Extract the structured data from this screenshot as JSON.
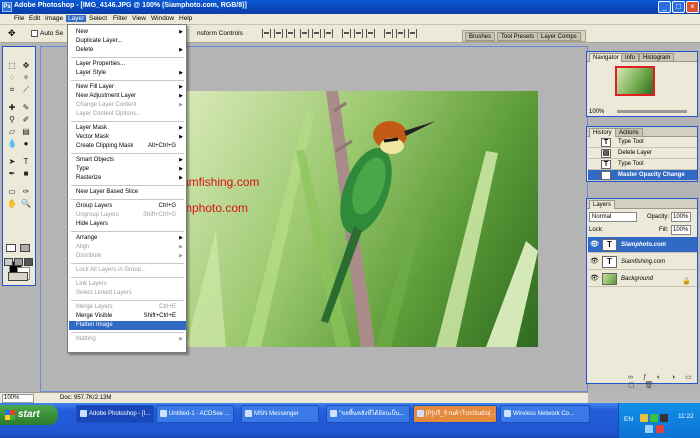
{
  "window": {
    "title": "Adobe Photoshop - [IMG_4146.JPG @ 100% (Siamphoto.com, RGB/8)]",
    "buttons": {
      "minimize": "_",
      "maximize": "□",
      "close": "×"
    }
  },
  "menubar": [
    "File",
    "Edit",
    "Image",
    "Layer",
    "Select",
    "Filter",
    "View",
    "Window",
    "Help"
  ],
  "options": {
    "auto_select_label": "Auto Se",
    "transform_label": "nsform Controls"
  },
  "palette_well": [
    "Brushes",
    "Tool Presets",
    "Layer Comps"
  ],
  "layer_menu": [
    {
      "label": "New",
      "arrow": true
    },
    {
      "label": "Duplicate Layer..."
    },
    {
      "label": "Delete",
      "arrow": true
    },
    {
      "sep": true
    },
    {
      "label": "Layer Properties..."
    },
    {
      "label": "Layer Style",
      "arrow": true
    },
    {
      "sep": true
    },
    {
      "label": "New Fill Layer",
      "arrow": true
    },
    {
      "label": "New Adjustment Layer",
      "arrow": true
    },
    {
      "label": "Change Layer Content",
      "arrow": true,
      "disabled": true
    },
    {
      "label": "Layer Content Options...",
      "disabled": true
    },
    {
      "sep": true
    },
    {
      "label": "Layer Mask",
      "arrow": true
    },
    {
      "label": "Vector Mask",
      "arrow": true
    },
    {
      "label": "Create Clipping Mask",
      "shortcut": "Alt+Ctrl+G"
    },
    {
      "sep": true
    },
    {
      "label": "Smart Objects",
      "arrow": true
    },
    {
      "label": "Type",
      "arrow": true
    },
    {
      "label": "Rasterize",
      "arrow": true
    },
    {
      "sep": true
    },
    {
      "label": "New Layer Based Slice"
    },
    {
      "sep": true
    },
    {
      "label": "Group Layers",
      "shortcut": "Ctrl+G"
    },
    {
      "label": "Ungroup Layers",
      "shortcut": "Shift+Ctrl+G",
      "disabled": true
    },
    {
      "label": "Hide Layers"
    },
    {
      "sep": true
    },
    {
      "label": "Arrange",
      "arrow": true
    },
    {
      "label": "Align",
      "arrow": true,
      "disabled": true
    },
    {
      "label": "Distribute",
      "arrow": true,
      "disabled": true
    },
    {
      "sep": true
    },
    {
      "label": "Lock All Layers in Group...",
      "disabled": true
    },
    {
      "sep": true
    },
    {
      "label": "Link Layers",
      "disabled": true
    },
    {
      "label": "Select Linked Layers",
      "disabled": true
    },
    {
      "sep": true
    },
    {
      "label": "Merge Layers",
      "shortcut": "Ctrl+E",
      "disabled": true
    },
    {
      "label": "Merge Visible",
      "shortcut": "Shift+Ctrl+E"
    },
    {
      "label": "Flatten Image",
      "highlighted": true
    },
    {
      "sep": true
    },
    {
      "label": "Matting",
      "arrow": true,
      "disabled": true
    }
  ],
  "document": {
    "watermark1": "amfishing.com",
    "watermark2": "mphoto.com",
    "zoom": "100%",
    "doc_info": "Doc: 957.7K/2.13M"
  },
  "navigator": {
    "tabs": [
      "Navigator",
      "Info",
      "Histogram"
    ],
    "zoom": "100%"
  },
  "history": {
    "tabs": [
      "History",
      "Actions"
    ],
    "rows": [
      {
        "label": "Type Tool",
        "icon": "T"
      },
      {
        "label": "Delete Layer",
        "icon": "▤"
      },
      {
        "label": "Type Tool",
        "icon": "T"
      },
      {
        "label": "Master Opacity Change",
        "icon": "▤",
        "selected": true
      }
    ]
  },
  "layers": {
    "tab": "Layers",
    "blend_mode": "Normal",
    "opacity_label": "Opacity:",
    "opacity": "100%",
    "lock_label": "Lock:",
    "fill_label": "Fill:",
    "fill": "100%",
    "rows": [
      {
        "name": "Siamphoto.com",
        "thumb": "T",
        "selected": true
      },
      {
        "name": "Siamfishing.com",
        "thumb": "T"
      },
      {
        "name": "Background",
        "thumb": "",
        "locked": true
      }
    ],
    "footer_icons": [
      "link-icon",
      "fx-icon",
      "mask-icon",
      "adjust-icon",
      "folder-icon",
      "new-layer-icon",
      "trash-icon"
    ]
  },
  "taskbar": {
    "start": "start",
    "items": [
      {
        "label": "Adobe Photoshop - [I...",
        "active": true
      },
      {
        "label": "Untitled-1 - ACDSee ..."
      },
      {
        "label": "MSN Messenger"
      },
      {
        "label": "\"ขอพื้นหลังที่ได้ย้อนเป็น..."
      },
      {
        "label": "[P]ปรี_ร้านค้าโปรStudio[...",
        "orange": true
      },
      {
        "label": "Wireless Network Co..."
      }
    ],
    "lang": "EN",
    "clock": "11:22"
  },
  "colors": {
    "accent": "#316ac5",
    "watermark": "#dd1111",
    "titlebar": "#0a5bd8"
  }
}
